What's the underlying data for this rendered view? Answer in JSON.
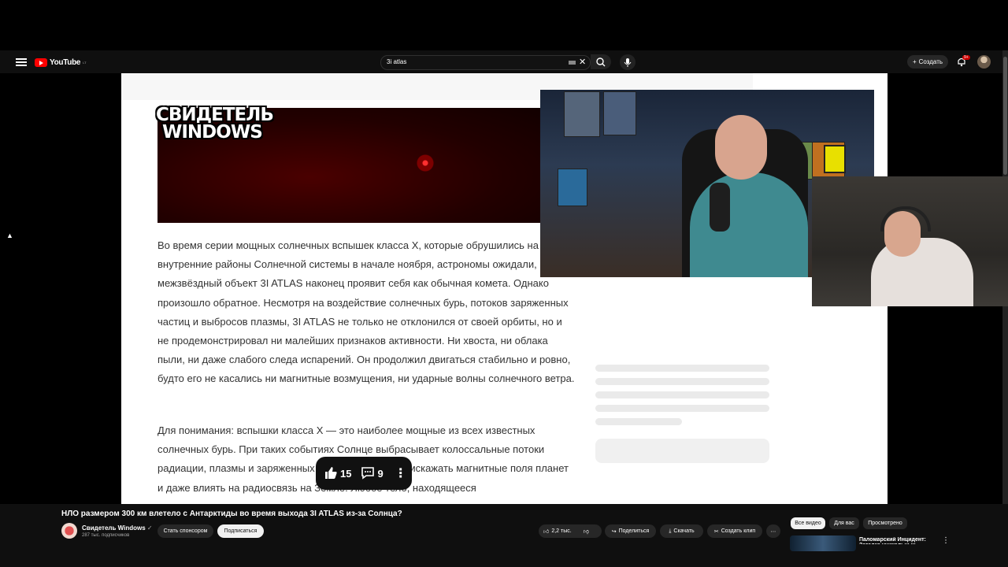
{
  "topbar": {
    "logo_text": "YouTube",
    "logo_superscript": "LT",
    "search_value": "3i atlas",
    "create_label": "Создать",
    "notifications_badge": "9+"
  },
  "video": {
    "hero_logo_line1": "СВИДЕТЕЛЬ",
    "hero_logo_line2": "WINDOWS",
    "paragraph1": "Во время серии мощных солнечных вспышек класса X, которые обрушились на внутренние районы Солнечной системы в начале ноября, астрономы ожидали, межзвёздный объект 3I ATLAS наконец проявит себя как обычная комета. Однако произошло обратное. Несмотря на воздействие солнечных бурь, потоков заряженных частиц и выбросов плазмы, 3I ATLAS не только не отклонился от своей орбиты, но и не продемонстрировал ни малейших признаков активности. Ни хвоста, ни облака пыли, ни даже слабого следа испарений. Он продолжил двигаться стабильно и ровно, будто его не касались ни магнитные возмущения, ни ударные волны солнечного ветра.",
    "paragraph2": "Для понимания: вспышки класса X — это наиболее мощные из всех известных солнечных бурь. При таких событиях Солнце выбрасывает колоссальные потоки радиации, плазмы и заряженных частиц, способных искажать магнитные поля планет и даже влиять на радиосвязь на Земле. Любое тело, находящееся",
    "overlay": {
      "likes": "15",
      "comments": "9"
    }
  },
  "info": {
    "title": "НЛО размером 300 км влетело с Антарктиды во время выхода 3I ATLAS из-за Солнца?",
    "channel_name": "Свидетель Windows",
    "subscribers": "287 тыс. подписчиков",
    "sponsor_label": "Стать спонсором",
    "subscribe_label": "Подписаться",
    "likes_label": "2,2 тыс.",
    "share_label": "Поделиться",
    "download_label": "Скачать",
    "clip_label": "Создать клип"
  },
  "sidebar": {
    "chips": [
      "Все видео",
      "Для вас",
      "Просмотрено"
    ],
    "rec_title": "Паломарский Инцидент: Загадка уникальных"
  },
  "colors": {
    "brand_red": "#ff0000",
    "hero_red": "#ff3030",
    "background": "#0f0f0f"
  }
}
